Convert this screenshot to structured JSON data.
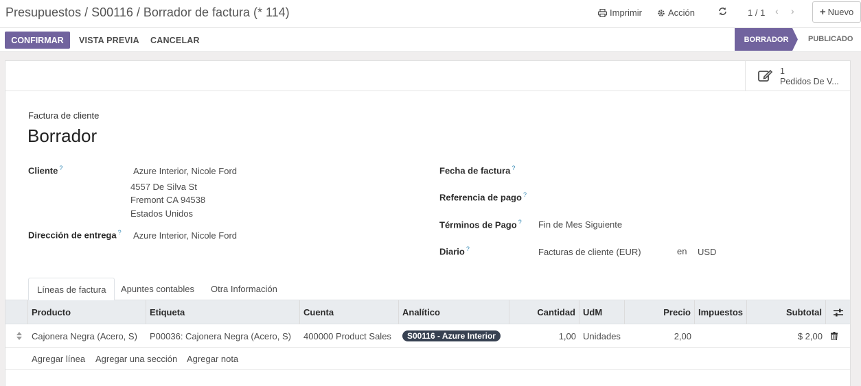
{
  "breadcrumb": {
    "items": [
      "Presupuestos",
      "S00116",
      "Borrador de factura (* 114)"
    ],
    "sep": "/"
  },
  "toolbar": {
    "print_label": "Imprimir",
    "action_label": "Acción",
    "pager": "1 / 1",
    "new_label": "Nuevo"
  },
  "actions": {
    "confirm": "CONFIRMAR",
    "preview": "VISTA PREVIA",
    "cancel": "CANCELAR"
  },
  "status": {
    "active": "BORRADOR",
    "next": "PUBLICADO"
  },
  "smart_button": {
    "value": "1",
    "label": "Pedidos De V..."
  },
  "form": {
    "subtitle": "Factura de cliente",
    "title": "Borrador",
    "help": "?",
    "customer_label": "Cliente",
    "customer_name": "Azure Interior, Nicole Ford",
    "address_line1": "4557 De Silva St",
    "address_line2": "Fremont CA 94538",
    "address_line3": "Estados Unidos",
    "delivery_label": "Dirección de entrega",
    "delivery_value": "Azure Interior, Nicole Ford",
    "invoice_date_label": "Fecha de factura",
    "payment_ref_label": "Referencia de pago",
    "payment_terms_label": "Términos de Pago",
    "payment_terms_value": "Fin de Mes Siguiente",
    "journal_label": "Diario",
    "journal_value": "Facturas de cliente (EUR)",
    "currency_in": "en",
    "currency": "USD"
  },
  "tabs": [
    "Líneas de factura",
    "Apuntes contables",
    "Otra Información"
  ],
  "table": {
    "headers": [
      "Producto",
      "Etiqueta",
      "Cuenta",
      "Analítico",
      "Cantidad",
      "UdM",
      "Precio",
      "Impuestos",
      "Subtotal"
    ],
    "rows": [
      {
        "product": "Cajonera Negra (Acero, S)",
        "label": "P00036: Cajonera Negra (Acero, S)",
        "account": "400000 Product Sales",
        "analytic": "S00116 - Azure Interior",
        "quantity": "1,00",
        "uom": "Unidades",
        "price": "2,00",
        "taxes": "",
        "subtotal": "$ 2,00"
      }
    ],
    "add_line": "Agregar línea",
    "add_section": "Agregar una sección",
    "add_note": "Agregar nota"
  },
  "colors": {
    "primary": "#71639e",
    "tag_bg": "#374151"
  }
}
